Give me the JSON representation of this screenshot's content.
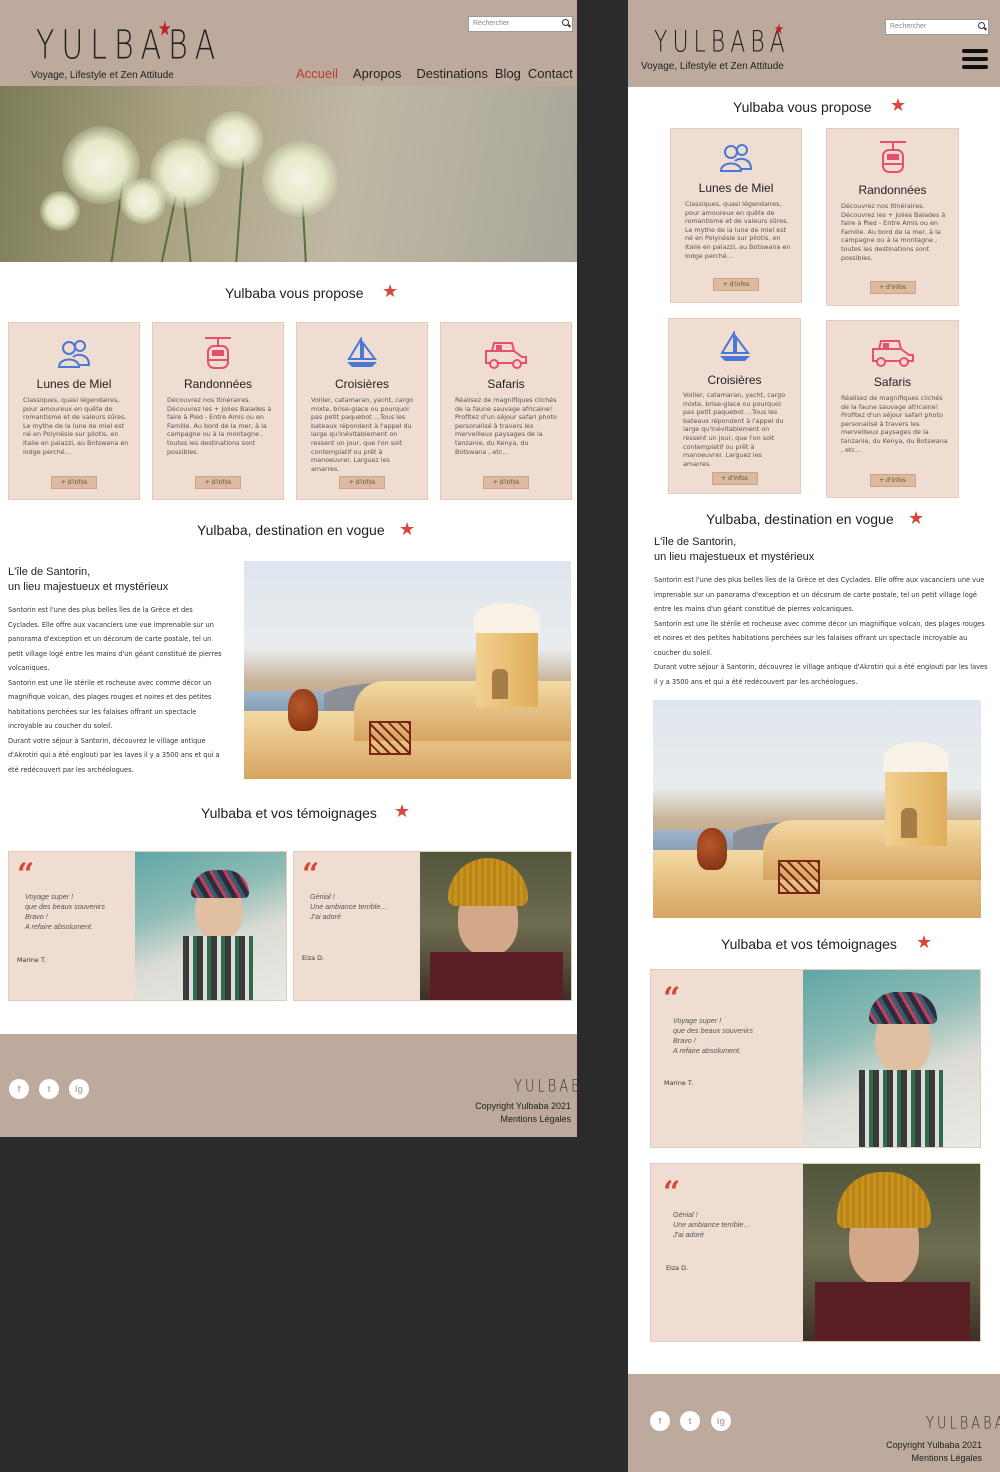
{
  "brand": {
    "logo": "YULBABA",
    "logo_star": "★",
    "tagline": "Voyage, Lifestyle et Zen Attitude"
  },
  "search": {
    "placeholder": "Rechercher"
  },
  "nav": [
    {
      "label": "Accueil",
      "active": true
    },
    {
      "label": "Apropos",
      "active": false
    },
    {
      "label": "Destinations",
      "active": false
    },
    {
      "label": "Blog",
      "active": false
    },
    {
      "label": "Contact",
      "active": false
    }
  ],
  "sections": {
    "propose": "Yulbaba vous propose",
    "vogue": "Yulbaba, destination en vogue",
    "temoignages": "Yulbaba et vos témoignages"
  },
  "cards": [
    {
      "icon": "couple-icon",
      "title": "Lunes de Miel",
      "desc": "Classiques, quasi légendaires, pour amoureux en quête de romantisme et de valeurs sûres. Le mythe de la lune de miel est né en Polynésie sur pilotis, en Italie en palazzi, au Botswana en lodge perché…",
      "btn": "+ d'infos"
    },
    {
      "icon": "cable-car-icon",
      "title": "Randonnées",
      "desc": "Découvrez nos Itinéraires. Découvrez les + Jolies Balades à faire à Pied - Entre Amis ou en Famille. Au bord de la mer, à la campagne ou à la montagne , toutes les destinations sont possibles.",
      "btn": "+ d'infos"
    },
    {
      "icon": "sailboat-icon",
      "title": "Croisières",
      "desc": "Voilier, catamaran, yacht, cargo mixte, brise-glace ou pourquoi pas petit paquebot …Tous les bateaux répondent à l'appel du large qu'inévitablement on ressent un jour, que l'on soit contemplatif ou prêt à manoeuvrer. Larguez les amarres.",
      "btn": "+ d'infos"
    },
    {
      "icon": "jeep-icon",
      "title": "Safaris",
      "desc": "Réalisez de magnifiques clichés de la faune sauvage africaine! Profitez d'un séjour safari photo personalisé à travers les merveilleux paysages de la tanzanie, du Kenya, du Botswana , etc…",
      "btn": "+ d'infos"
    }
  ],
  "article": {
    "heading1": "L'île de Santorin,",
    "heading2": "un lieu majestueux et mystérieux",
    "p1": "Santorin est l'une des plus belles îles de la Grèce et des Cyclades. Elle offre aux vacanciers une vue imprenable sur un panorama d'exception et un décorum de carte postale, tel un petit village logé entre les mains d'un géant constitué de pierres volcaniques.",
    "p2": "Santorin est une île stérile et rocheuse avec comme décor un magnifique volcan, des plages rouges et noires et des petites habitations perchées sur les falaises offrant un spectacle incroyable au coucher du soleil.",
    "p3": "Durant votre séjour à Santorin, découvrez le village antique d'Akrotiri qui a été englouti par les laves il y a 3500 ans et qui a été redécouvert par les archéologues."
  },
  "testimonials": [
    {
      "quote_mark": "“",
      "lines": [
        "Voyage super !",
        "que des beaux souvenirs",
        "Bravo !",
        "A refaire absolument."
      ],
      "name": "Marine T."
    },
    {
      "quote_mark": "“",
      "lines": [
        "Génial !",
        "Une ambiance terrible…",
        "J'ai adoré"
      ],
      "name": "Elza D."
    }
  ],
  "footer": {
    "social": [
      "f",
      "t",
      "ig"
    ],
    "social_icons": [
      "facebook-icon",
      "twitter-icon",
      "instagram-icon"
    ],
    "copyright": "Copyright Yulbaba 2021",
    "legal": "Mentions Légales"
  },
  "colors": {
    "header_bg": "#bdaa9c",
    "card_bg": "#f0ddd2",
    "accent": "#d9473b",
    "button": "#dcb99f"
  }
}
